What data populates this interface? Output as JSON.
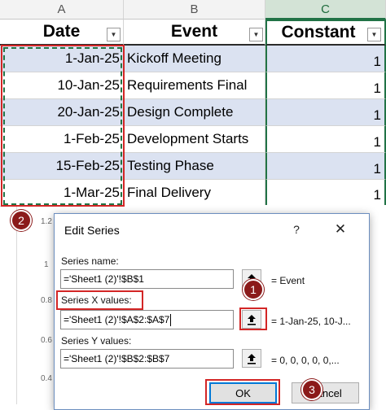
{
  "sheet": {
    "columns": [
      "A",
      "B",
      "C"
    ],
    "headers": [
      "Date",
      "Event",
      "Constant"
    ],
    "rows": [
      {
        "date": "1-Jan-25",
        "event": "Kickoff Meeting",
        "constant": "1"
      },
      {
        "date": "10-Jan-25",
        "event": "Requirements Final",
        "constant": "1"
      },
      {
        "date": "20-Jan-25",
        "event": "Design Complete",
        "constant": "1"
      },
      {
        "date": "1-Feb-25",
        "event": "Development Starts",
        "constant": "1"
      },
      {
        "date": "15-Feb-25",
        "event": "Testing Phase",
        "constant": "1"
      },
      {
        "date": "1-Mar-25",
        "event": "Final Delivery",
        "constant": "1"
      }
    ],
    "filter_icon": "dropdown-arrow-icon"
  },
  "chart_axis_labels": [
    "1.2",
    "1",
    "0.8",
    "0.6",
    "0.4"
  ],
  "dialog": {
    "title": "Edit Series",
    "help_label": "?",
    "close_label": "✕",
    "series_name": {
      "label": "Series name:",
      "value": "='Sheet1 (2)'!$B$1",
      "result": "= Event"
    },
    "series_x": {
      "label": "Series X values:",
      "value": "='Sheet1 (2)'!$A$2:$A$7",
      "result": "= 1-Jan-25, 10-J..."
    },
    "series_y": {
      "label": "Series Y values:",
      "value": "='Sheet1 (2)'!$B$2:$B$7",
      "result": "= 0, 0, 0, 0, 0,..."
    },
    "ok_label": "OK",
    "cancel_label": "Cancel"
  },
  "markers": [
    "1",
    "2",
    "3"
  ],
  "colors": {
    "accent_red": "#d32626",
    "marker_fill": "#8b1a1a",
    "band_blue": "#dbe2f1",
    "excel_green": "#217346"
  }
}
